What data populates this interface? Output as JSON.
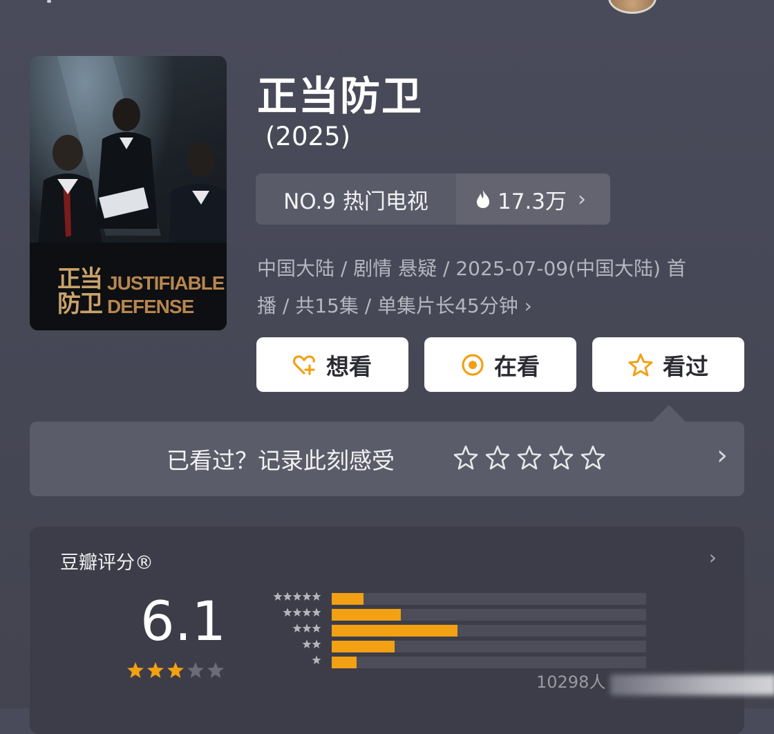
{
  "header": {
    "avatar_icon": "user-avatar"
  },
  "poster": {
    "title_zh": "正当\n防卫",
    "title_en": "JUSTIFIABLE DEFENSE"
  },
  "title": "正当防卫",
  "year": "(2025)",
  "rank": {
    "label": "NO.9 热门电视",
    "heat": "17.3万"
  },
  "meta": {
    "line1": "中国大陆 / 剧情 悬疑 / 2025-07-09(中国大陆) 首",
    "line2": "播 / 共15集 / 单集片长45分钟"
  },
  "actions": {
    "want": "想看",
    "watching": "在看",
    "watched": "看过"
  },
  "rate_prompt": "已看过？记录此刻感受",
  "rating": {
    "label": "豆瓣评分®",
    "score": "6.1",
    "stars_filled": 3,
    "stars_total": 5,
    "distribution_percent": [
      10,
      22,
      40,
      20,
      8
    ],
    "voters": "10298人"
  },
  "colors": {
    "accent": "#f2a014",
    "panel": "#5b5c69",
    "card": "#3c3d48"
  }
}
